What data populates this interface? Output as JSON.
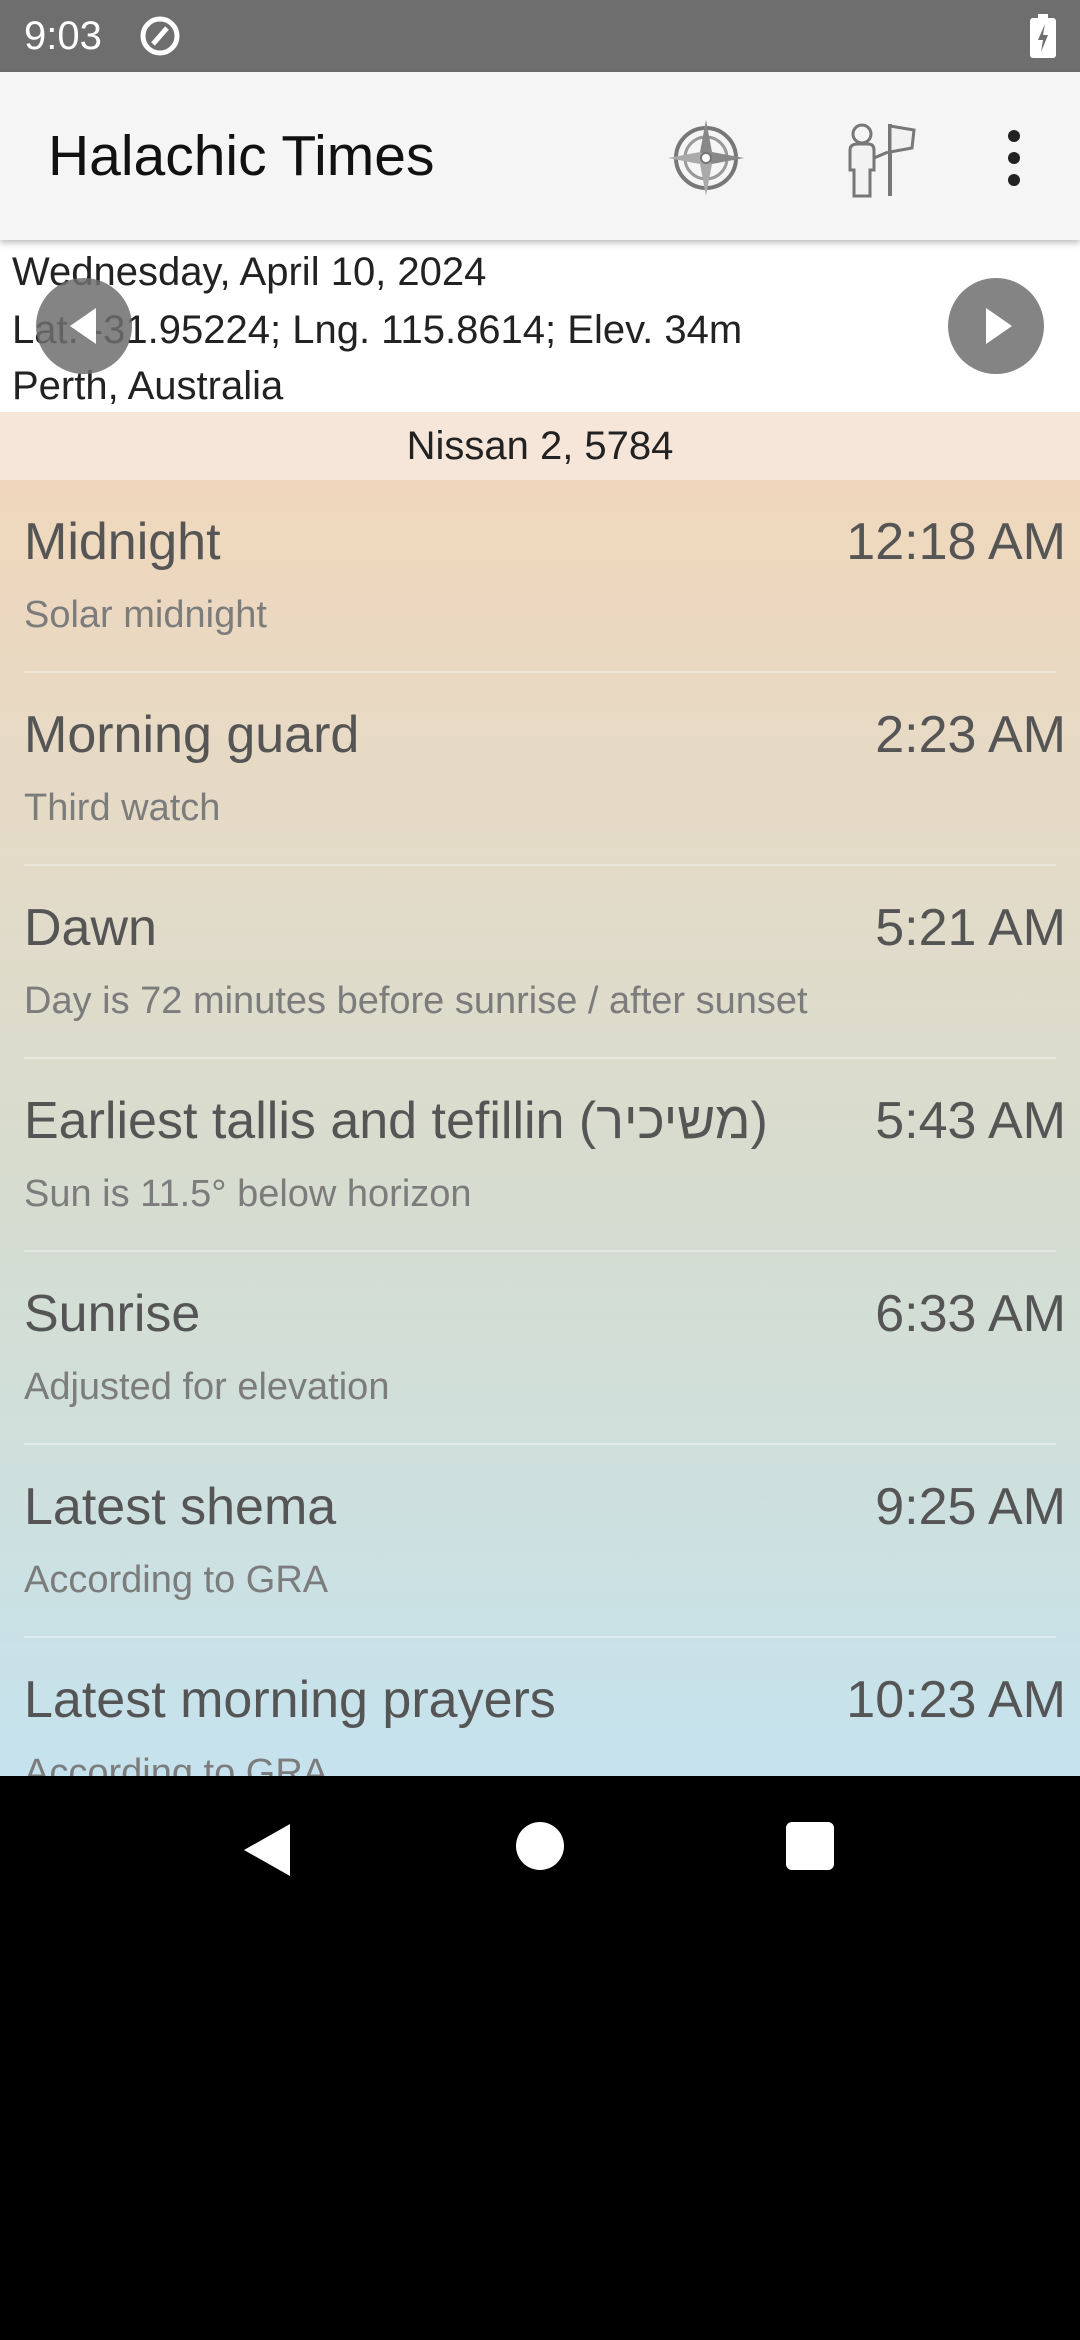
{
  "status_bar": {
    "time": "9:03",
    "left_icon": "at-sign-icon",
    "battery_icon": "battery-charging-icon"
  },
  "app_bar": {
    "title": "Halachic Times",
    "compass_icon": "compass-icon",
    "location_icon": "location-map-icon",
    "overflow_icon": "more-vert-icon"
  },
  "header": {
    "date": "Wednesday, April 10, 2024",
    "coordinates": "Lat. -31.95224; Lng. 115.8614; Elev. 34m",
    "location": "Perth, Australia",
    "prev_icon": "chevron-left-icon",
    "next_icon": "play-arrow-icon"
  },
  "hebrew_date": "Nissan 2, 5784",
  "times": [
    {
      "title": "Midnight",
      "time": "12:18 AM",
      "subtitle": "Solar midnight"
    },
    {
      "title": "Morning guard",
      "time": "2:23 AM",
      "subtitle": "Third watch"
    },
    {
      "title": "Dawn",
      "time": "5:21 AM",
      "subtitle": "Day is 72 minutes before sunrise / after sunset"
    },
    {
      "title": "Earliest tallis and tefillin (משיכיר)",
      "time": "5:43 AM",
      "subtitle": "Sun is 11.5° below horizon"
    },
    {
      "title": "Sunrise",
      "time": "6:33 AM",
      "subtitle": "Adjusted for elevation"
    },
    {
      "title": "Latest shema",
      "time": "9:25 AM",
      "subtitle": "According to GRA"
    },
    {
      "title": "Latest morning prayers",
      "time": "10:23 AM",
      "subtitle": "According to GRA"
    }
  ],
  "nav_bar": {
    "back_icon": "back-triangle-icon",
    "home_icon": "home-circle-icon",
    "recents_icon": "recents-square-icon"
  },
  "colors": {
    "status_bar": "#6e6e6e",
    "app_bar": "#f5f5f5",
    "hebrew_strip": "#f6e6da",
    "list_top": "#f0d7bc",
    "list_bottom": "#c5e2ee"
  }
}
